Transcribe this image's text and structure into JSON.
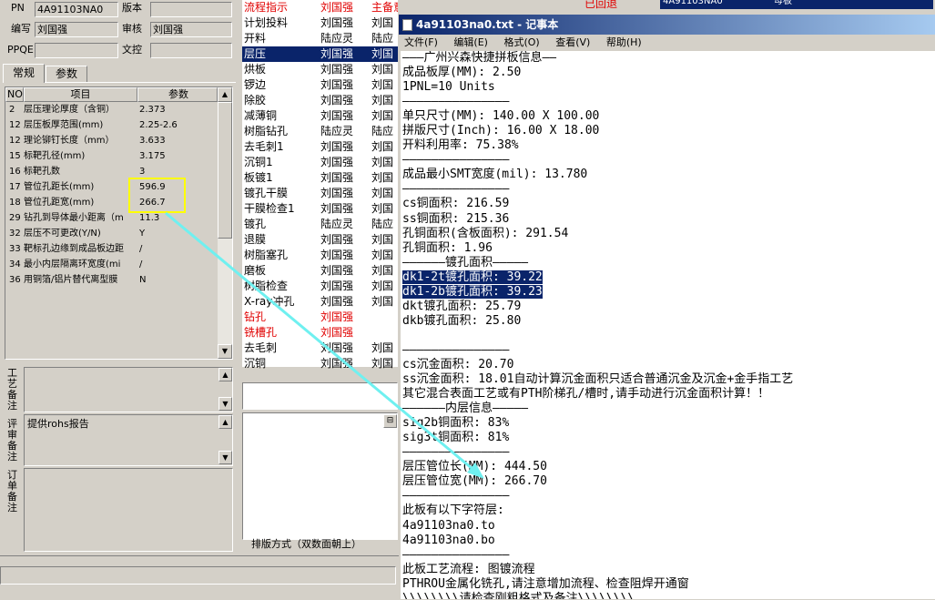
{
  "header": {
    "pn_label": "PN",
    "pn_value": "4A91103NA0",
    "version_label": "版本",
    "version_value": "",
    "author_label": "编写",
    "author_value": "刘国强",
    "reviewer_label": "审核",
    "reviewer_value": "刘国强",
    "ppqe_label": "PPQE",
    "ppqe_value": "",
    "doc_label": "文控",
    "doc_value": ""
  },
  "tabs": [
    "常规",
    "参数"
  ],
  "grid": {
    "columns": [
      "NO",
      "项目",
      "参数"
    ],
    "rows": [
      {
        "no": "2",
        "item": "层压理论厚度（含铜）",
        "val": "2.373"
      },
      {
        "no": "12",
        "item": "层压板厚范围(mm)",
        "val": "2.25-2.6"
      },
      {
        "no": "12",
        "item": "理论铆钉长度（mm）",
        "val": "3.633"
      },
      {
        "no": "15",
        "item": "标靶孔径(mm)",
        "val": "3.175"
      },
      {
        "no": "16",
        "item": "标靶孔数",
        "val": "3"
      },
      {
        "no": "17",
        "item": "管位孔距长(mm)",
        "val": "596.9"
      },
      {
        "no": "18",
        "item": "管位孔距宽(mm)",
        "val": "266.7"
      },
      {
        "no": "29",
        "item": "钻孔到导体最小距离（m",
        "val": "11.3"
      },
      {
        "no": "32",
        "item": "层压不可更改(Y/N)",
        "val": "Y"
      },
      {
        "no": "33",
        "item": "靶标孔边缘到成品板边距",
        "val": "/"
      },
      {
        "no": "34",
        "item": "最小内层隔离环宽度(mi",
        "val": "/"
      },
      {
        "no": "36",
        "item": "用铜箔/铝片替代离型膜",
        "val": "N"
      }
    ]
  },
  "notes": {
    "process_label": "工艺备注",
    "review_label": "评审备注",
    "review_text": "提供rohs报告",
    "order_label": "订单备注"
  },
  "mid_list": {
    "rows": [
      {
        "a": "流程指示",
        "b": "刘国强",
        "c": "主备意",
        "style": "red"
      },
      {
        "a": "计划投料",
        "b": "刘国强",
        "c": "刘国",
        "style": ""
      },
      {
        "a": "开料",
        "b": "陆应灵",
        "c": "陆应",
        "style": ""
      },
      {
        "a": "层压",
        "b": "刘国强",
        "c": "刘国",
        "style": "sel"
      },
      {
        "a": "烘板",
        "b": "刘国强",
        "c": "刘国",
        "style": ""
      },
      {
        "a": "锣边",
        "b": "刘国强",
        "c": "刘国",
        "style": ""
      },
      {
        "a": "除胶",
        "b": "刘国强",
        "c": "刘国",
        "style": ""
      },
      {
        "a": "减薄铜",
        "b": "刘国强",
        "c": "刘国",
        "style": ""
      },
      {
        "a": "树脂钻孔",
        "b": "陆应灵",
        "c": "陆应",
        "style": ""
      },
      {
        "a": "去毛刺1",
        "b": "刘国强",
        "c": "刘国",
        "style": ""
      },
      {
        "a": "沉铜1",
        "b": "刘国强",
        "c": "刘国",
        "style": ""
      },
      {
        "a": "板镀1",
        "b": "刘国强",
        "c": "刘国",
        "style": ""
      },
      {
        "a": "镀孔干膜",
        "b": "刘国强",
        "c": "刘国",
        "style": ""
      },
      {
        "a": "干膜检查1",
        "b": "刘国强",
        "c": "刘国",
        "style": ""
      },
      {
        "a": "镀孔",
        "b": "陆应灵",
        "c": "陆应",
        "style": ""
      },
      {
        "a": "退膜",
        "b": "刘国强",
        "c": "刘国",
        "style": ""
      },
      {
        "a": "树脂塞孔",
        "b": "刘国强",
        "c": "刘国",
        "style": ""
      },
      {
        "a": "磨板",
        "b": "刘国强",
        "c": "刘国",
        "style": ""
      },
      {
        "a": "树脂检查",
        "b": "刘国强",
        "c": "刘国",
        "style": ""
      },
      {
        "a": "X-ray冲孔",
        "b": "刘国强",
        "c": "刘国",
        "style": ""
      },
      {
        "a": "钻孔",
        "b": "刘国强",
        "c": "",
        "style": "red"
      },
      {
        "a": "铣槽孔",
        "b": "刘国强",
        "c": "",
        "style": "red"
      },
      {
        "a": "去毛刺",
        "b": "刘国强",
        "c": "刘国",
        "style": ""
      },
      {
        "a": "沉铜",
        "b": "刘国强",
        "c": "刘国",
        "style": ""
      }
    ],
    "sort_label": "排版方式（双数面朝上）"
  },
  "top_right": {
    "status": "已回退",
    "cell1": "4A91103NA0",
    "cell2": "母板"
  },
  "notepad": {
    "title": "4a91103na0.txt - 记事本",
    "menu": [
      "文件(F)",
      "编辑(E)",
      "格式(O)",
      "查看(V)",
      "帮助(H)"
    ],
    "lines": [
      "———广州兴森快捷拼板信息——",
      "成品板厚(MM): 2.50",
      "1PNL=10 Units",
      "———————————————",
      "单只尺寸(MM): 140.00 X 100.00",
      "拼版尺寸(Inch): 16.00 X 18.00",
      "开料利用率: 75.38%",
      "———————————————",
      "成品最小SMT宽度(mil): 13.780",
      "———————————————",
      "cs铜面积: 216.59",
      "ss铜面积: 215.36",
      "孔铜面积(含板面积): 291.54",
      "孔铜面积: 1.96",
      "——————镀孔面积—————",
      "dk1-2t镀孔面积: 39.22",
      "dk1-2b镀孔面积: 39.23",
      "dkt镀孔面积: 25.79",
      "dkb镀孔面积: 25.80",
      "",
      "———————————————",
      "cs沉金面积: 20.70",
      "ss沉金面积: 18.01自动计算沉金面积只适合普通沉金及沉金+金手指工艺",
      "其它混合表面工艺或有PTH阶梯孔/槽时,请手动进行沉金面积计算！！",
      "——————内层信息—————",
      "sig2b铜面积: 83%",
      "sig3t铜面积: 81%",
      "———————————————",
      "层压管位长(MM): 444.50",
      "层压管位宽(MM): 266.70",
      "———————————————",
      "此板有以下字符层:",
      "4a91103na0.to",
      "4a91103na0.bo",
      "———————————————",
      "此板工艺流程: 图镀流程",
      "PTHROU金属化铣孔,请注意增加流程、检查阻焊开通窗",
      "\\\\\\\\\\\\\\\\请检查刚粗格式及备注\\\\\\\\\\\\\\\\"
    ],
    "highlighted": [
      15,
      16
    ]
  }
}
